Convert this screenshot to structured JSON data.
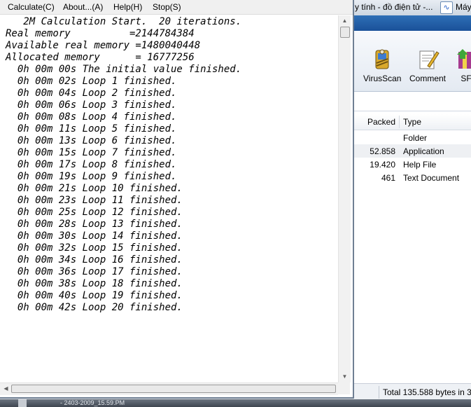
{
  "menu": {
    "items": [
      "Calculate(C)",
      "About...(A)",
      "Help(H)",
      "Stop(S)"
    ]
  },
  "console": {
    "lines": [
      "   2M Calculation Start.  20 iterations.",
      "Real memory          =2144784384",
      "Available real memory =1480040448",
      "Allocated memory      = 16777256",
      "  0h 00m 00s The initial value finished.",
      "  0h 00m 02s Loop 1 finished.",
      "  0h 00m 04s Loop 2 finished.",
      "  0h 00m 06s Loop 3 finished.",
      "  0h 00m 08s Loop 4 finished.",
      "  0h 00m 11s Loop 5 finished.",
      "  0h 00m 13s Loop 6 finished.",
      "  0h 00m 15s Loop 7 finished.",
      "  0h 00m 17s Loop 8 finished.",
      "  0h 00m 19s Loop 9 finished.",
      "  0h 00m 21s Loop 10 finished.",
      "  0h 00m 23s Loop 11 finished.",
      "  0h 00m 25s Loop 12 finished.",
      "  0h 00m 28s Loop 13 finished.",
      "  0h 00m 30s Loop 14 finished.",
      "  0h 00m 32s Loop 15 finished.",
      "  0h 00m 34s Loop 16 finished.",
      "  0h 00m 36s Loop 17 finished.",
      "  0h 00m 38s Loop 18 finished.",
      "  0h 00m 40s Loop 19 finished.",
      "  0h 00m 42s Loop 20 finished."
    ]
  },
  "background_window": {
    "title": "y tính - đồ điện tử -...",
    "app_label": "Máy",
    "toolbar": [
      {
        "label": "VirusScan",
        "icon": "virusscan-icon"
      },
      {
        "label": "Comment",
        "icon": "comment-icon"
      },
      {
        "label": "SF",
        "icon": "sfx-icon"
      }
    ],
    "columns": {
      "packed": "Packed",
      "type": "Type"
    },
    "files": [
      {
        "packed": "",
        "type": "Folder"
      },
      {
        "packed": "52.858",
        "type": "Application"
      },
      {
        "packed": "19.420",
        "type": "Help File"
      },
      {
        "packed": "461",
        "type": "Text Document"
      }
    ],
    "status": "Total 135.588 bytes in 3 f"
  },
  "taskbar": {
    "text": "- 2403-2009_15.59.PM"
  },
  "colors": {
    "console_text": "#000000",
    "background_menubar": "#1f5aa5",
    "window_border": "#6f7f93"
  }
}
